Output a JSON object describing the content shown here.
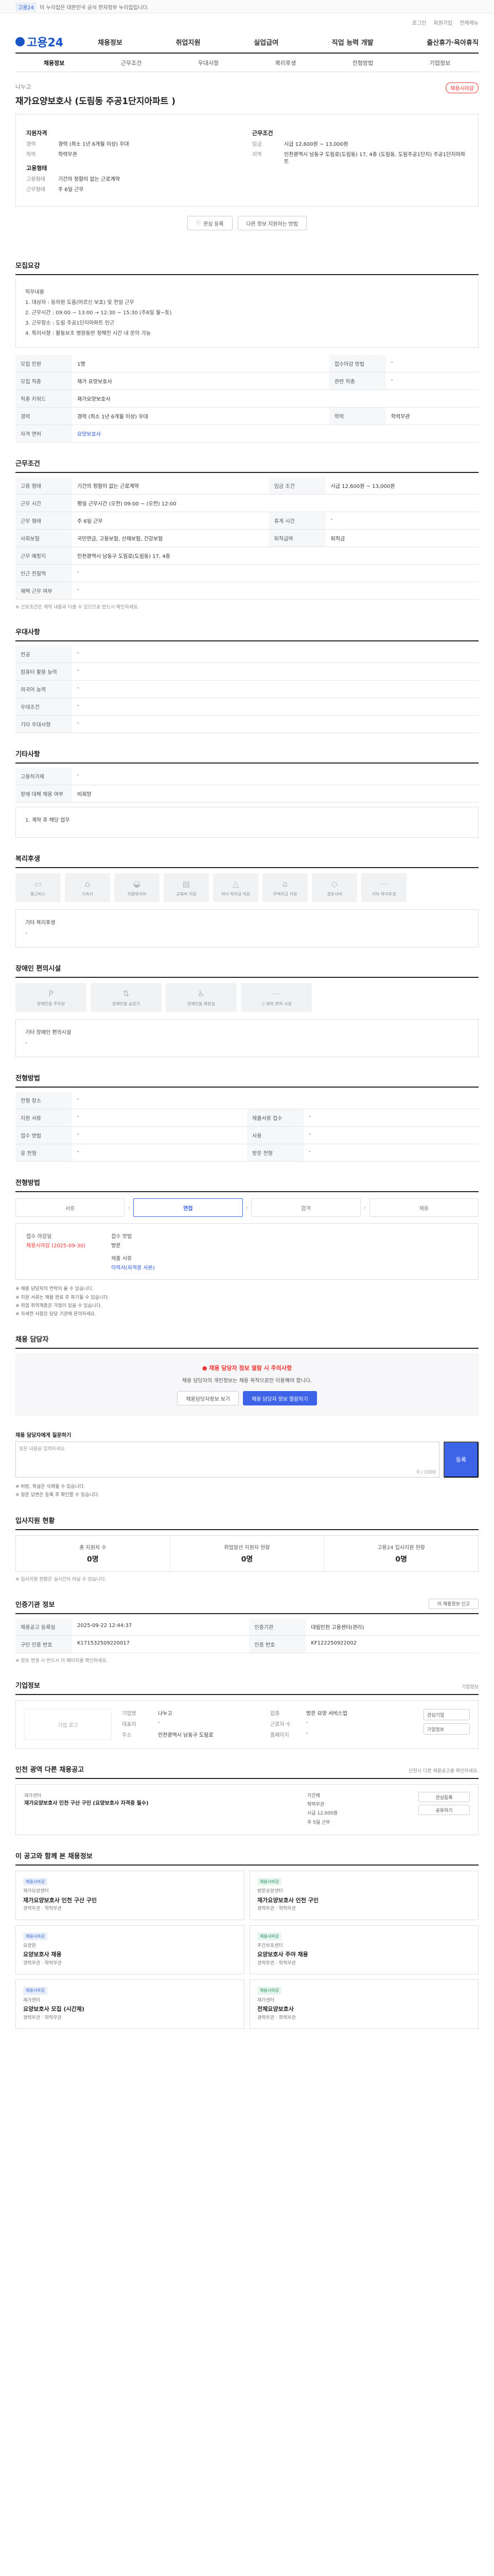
{
  "topbar": {
    "chip": "고용24",
    "text": "이 누리집은 대한민국 공식 전자정부 누리집입니다."
  },
  "util": [
    "로그인",
    "회원가입",
    "전체메뉴"
  ],
  "gnb": {
    "logo": "고용24",
    "menu": [
      "채용정보",
      "취업지원",
      "실업급여",
      "직업 능력 개발",
      "출산휴가·육아휴직"
    ]
  },
  "subnav": [
    "채용정보",
    "근무조건",
    "우대사항",
    "복리후생",
    "전형방법",
    "기업정보"
  ],
  "job": {
    "company": "나누고",
    "badge": "채용시마감",
    "title": "재가요양보호사 (도림동 주공1단지아파트 )",
    "sections": {
      "qual_title": "지원자격",
      "cond_title": "근무조건",
      "welfare_title": "고용형태"
    },
    "qual": [
      {
        "k": "경력",
        "v": "경력 (최소 1년 6개월 이상) 우대"
      },
      {
        "k": "학력",
        "v": "학력무관"
      }
    ],
    "cond": [
      {
        "k": "임금",
        "v": "시급 12,600원 ~ 13,000원"
      },
      {
        "k": "지역",
        "v": "인천광역시 남동구 도림로(도림동) 17, 4층 (도림동, 도림주공1단지) 주공1단지아파트"
      }
    ],
    "employ": [
      {
        "k": "고용형태",
        "v": "기간의 정함이 없는 근로계약"
      },
      {
        "k": "근무형태",
        "v": "주 6일 근무"
      }
    ]
  },
  "buttons": {
    "interest": "관심 등록",
    "share": "공유하기",
    "recent": "다른 정보 지원하는 방법"
  },
  "detail": {
    "title": "모집요강",
    "lines": [
      "직무내용",
      "1. 대상자 : 등하원 도움(어르신 보호) 및 전일 근무",
      "2. 근무시간 : 09:00 ~ 13:00 → 12:30 ~ 15:30 (주6일 월~토)",
      "3. 근무장소 : 도림 주공1단지아파트 인근",
      "4. 특이사항 : 활동보조 병원동반 정해진 시간 내 문의 가능"
    ]
  },
  "recruit_table": [
    {
      "k": "모집 인원",
      "v": "1명",
      "k2": "접수마감 방법",
      "v2": "-"
    },
    {
      "k": "모집 직종",
      "v": "재가 요양보호사",
      "k2": "관련 직종",
      "v2": "-"
    },
    {
      "k": "직종 키워드",
      "v": "재가요양보호사",
      "k2": "",
      "v2": ""
    },
    {
      "k": "경력",
      "v": "경력 (최소 1년 6개월 이상) 우대",
      "k2": "학력",
      "v2": "학력무관"
    },
    {
      "k": "자격 면허",
      "v": "요양보호사",
      "k2": "",
      "v2": ""
    }
  ],
  "work": {
    "title": "근무조건",
    "rows": [
      {
        "k": "고용 형태",
        "v": "기간의 정함이 없는 근로계약",
        "k2": "임금 조건",
        "v2": "시급 12,600원 ~ 13,000원"
      },
      {
        "k": "근무 시간",
        "v": "평일 근무시간 (오전) 09:00 ~ (오전) 12:00",
        "k2": "",
        "v2": ""
      },
      {
        "k": "근무 형태",
        "v": "주 6일 근무",
        "k2": "휴게 시간",
        "v2": "-"
      },
      {
        "k": "사회보험",
        "v": "국민연금, 고용보험, 산재보험, 건강보험",
        "k2": "퇴직급여",
        "v2": "퇴직금"
      },
      {
        "k": "근무 예정지",
        "v": "인천광역시 남동구 도림로(도림동) 17, 4층",
        "k2": "",
        "v2": ""
      },
      {
        "k": "인근 전철역",
        "v": "-",
        "k2": "",
        "v2": ""
      },
      {
        "k": "재택 근무 여부",
        "v": "-",
        "k2": "",
        "v2": ""
      }
    ],
    "note": "※ 근로조건은 계약 내용과 다를 수 있으므로 반드시 확인하세요."
  },
  "prefer": {
    "title": "우대사항",
    "rows": [
      {
        "k": "전공",
        "v": "-"
      },
      {
        "k": "컴퓨터 활용 능력",
        "v": "-"
      },
      {
        "k": "외국어 능력",
        "v": "-"
      },
      {
        "k": "우대조건",
        "v": "-"
      },
      {
        "k": "기타 우대사항",
        "v": "-"
      }
    ]
  },
  "etc": {
    "title": "기타사항",
    "rows": [
      {
        "k": "고용허가제",
        "v": "-"
      },
      {
        "k": "장애 대체 채용 여부",
        "v": "비희망"
      }
    ],
    "box": "1. 계약 후 해당 업무"
  },
  "welfare": {
    "title": "복리후생",
    "items": [
      "통근버스",
      "기숙사",
      "차량유지비",
      "교육비 지원",
      "자녀 학자금 지원",
      "주택자금 지원",
      "경조사비",
      "기타 복리후생"
    ],
    "note": "기타 복리후생",
    "note_val": "-"
  },
  "disabled": {
    "title": "장애인 편의시설",
    "items": [
      "장애인용 주차장",
      "장애인용 승강기",
      "장애인용 화장실",
      "그 밖의 편의 시설"
    ],
    "note": "기타 장애인 편의시설",
    "note_val": "-"
  },
  "selection": {
    "title": "전형방법",
    "rows": [
      {
        "k": "전형 장소",
        "v": "-"
      },
      {
        "k": "지원 서류",
        "v": "-",
        "k2": "제출서류 접수",
        "v2": "-"
      },
      {
        "k": "접수 방법",
        "v": "-",
        "k2": "사용",
        "v2": "-"
      },
      {
        "k": "응 전형",
        "v": "-",
        "k2": "방문 전형",
        "v2": "-"
      }
    ]
  },
  "process": {
    "title": "전형방법",
    "steps": [
      "서류",
      "면접",
      "합격",
      "채용"
    ],
    "apply_label": "접수 마감일",
    "apply_val": "채용시마감 (2025-09-30)",
    "method_label": "접수 방법",
    "method_val": "방문",
    "doc_label": "제출 서류",
    "doc_val": "이력서(자격증 사본)",
    "bullets": [
      "※ 채용 담당자의 연락이 올 수 있습니다.",
      "※ 지원 서류는 채용 완료 후 파기될 수 있습니다.",
      "※ 취업 취약계층은 가점이 있을 수 있습니다.",
      "※ 자세한 사항은 담당 기관에 문의하세요."
    ]
  },
  "contact": {
    "title": "채용 담당자",
    "warn": "채용 담당자 정보 열람 시 주의사항",
    "text": "채용 담당자의 개인정보는 채용 목적으로만 이용해야 합니다.",
    "btn1": "채용담당자정보 보기",
    "btn2": "채용 담당자 정보 열람하기"
  },
  "qa": {
    "label": "채용 담당자에게 질문하기",
    "placeholder": "질문 내용을 입력하세요.",
    "count": "0 / 1000",
    "submit": "등록",
    "notes": [
      "※ 비방, 욕설은 삭제될 수 있습니다.",
      "※ 질문 답변은 등록 후 확인할 수 있습니다."
    ]
  },
  "stats": {
    "title": "입사지원 현황",
    "items": [
      {
        "label": "총 지원자 수",
        "val": "0명"
      },
      {
        "label": "취업알선 지원자 현황",
        "val": "0명"
      },
      {
        "label": "고용24 입사지원 현황",
        "val": "0명"
      }
    ],
    "note": "※ 입사지원 현황은 실시간이 아닐 수 있습니다."
  },
  "mgmt": {
    "title": "인증기관 정보",
    "btn": "이 채용정보 신고",
    "rows": [
      {
        "k": "채용공고 등록일",
        "v": "2025-09-22 12:44:37",
        "k2": "인증기관",
        "v2": "대림인천 고용센터(관리)"
      },
      {
        "k": "구인 인증 번호",
        "v": "K171532509220017",
        "k2": "인증 번호",
        "v2": "KF122250922002"
      }
    ],
    "note": "※ 정보 변경 시 반드시 이 페이지를 확인하세요."
  },
  "company": {
    "title": "기업정보",
    "more": "기업정보",
    "logo": "기업 로고",
    "rows": [
      {
        "k": "기업명",
        "v": "나누고",
        "k2": "업종",
        "v2": "방문 요양 서비스업"
      },
      {
        "k": "대표자",
        "v": "-",
        "k2": "근로자 수",
        "v2": "-"
      },
      {
        "k": "주소",
        "v": "인천광역시 남동구 도림로",
        "k2": "홈페이지",
        "v2": "-"
      }
    ],
    "btns": [
      "관심기업",
      "기업정보"
    ]
  },
  "others": {
    "title": "인천 광역 다른 채용공고",
    "sub": "인천시 다른 채용공고를 확인하세요.",
    "co": "재가센터",
    "jt": "재가요양보호사 인천 구산 구인 (요양보호사 자격증 필수)",
    "meta": [
      "기간제",
      "학력무관",
      "시급 12,600원",
      "주 5일 근무"
    ],
    "btns": [
      "관심등록",
      "공유하기"
    ]
  },
  "recommend": {
    "title": "이 공고와 함께 본 채용정보",
    "cards": [
      {
        "tag": "채용시마감",
        "co": "재가요양센터",
        "jt": "재가요양보호사 인천 구산 구인",
        "meta": "경력무관 · 학력무관"
      },
      {
        "tag": "채용시마감",
        "co": "방문요양센터",
        "jt": "재가요양보호사 인천 구인",
        "meta": "경력무관 · 학력무관"
      },
      {
        "tag": "채용시마감",
        "co": "요양원",
        "jt": "요양보호사 채용",
        "meta": "경력무관 · 학력무관"
      },
      {
        "tag": "채용시마감",
        "co": "주간보호센터",
        "jt": "요양보호사 주야 채용",
        "meta": "경력무관 · 학력무관"
      },
      {
        "tag": "채용시마감",
        "co": "재가센터",
        "jt": "요양보호사 모집 (시간제)",
        "meta": "경력무관 · 학력무관"
      },
      {
        "tag": "채용시마감",
        "co": "재가센터",
        "jt": "전체요양보호사",
        "meta": "경력무관 · 학력무관"
      }
    ]
  }
}
